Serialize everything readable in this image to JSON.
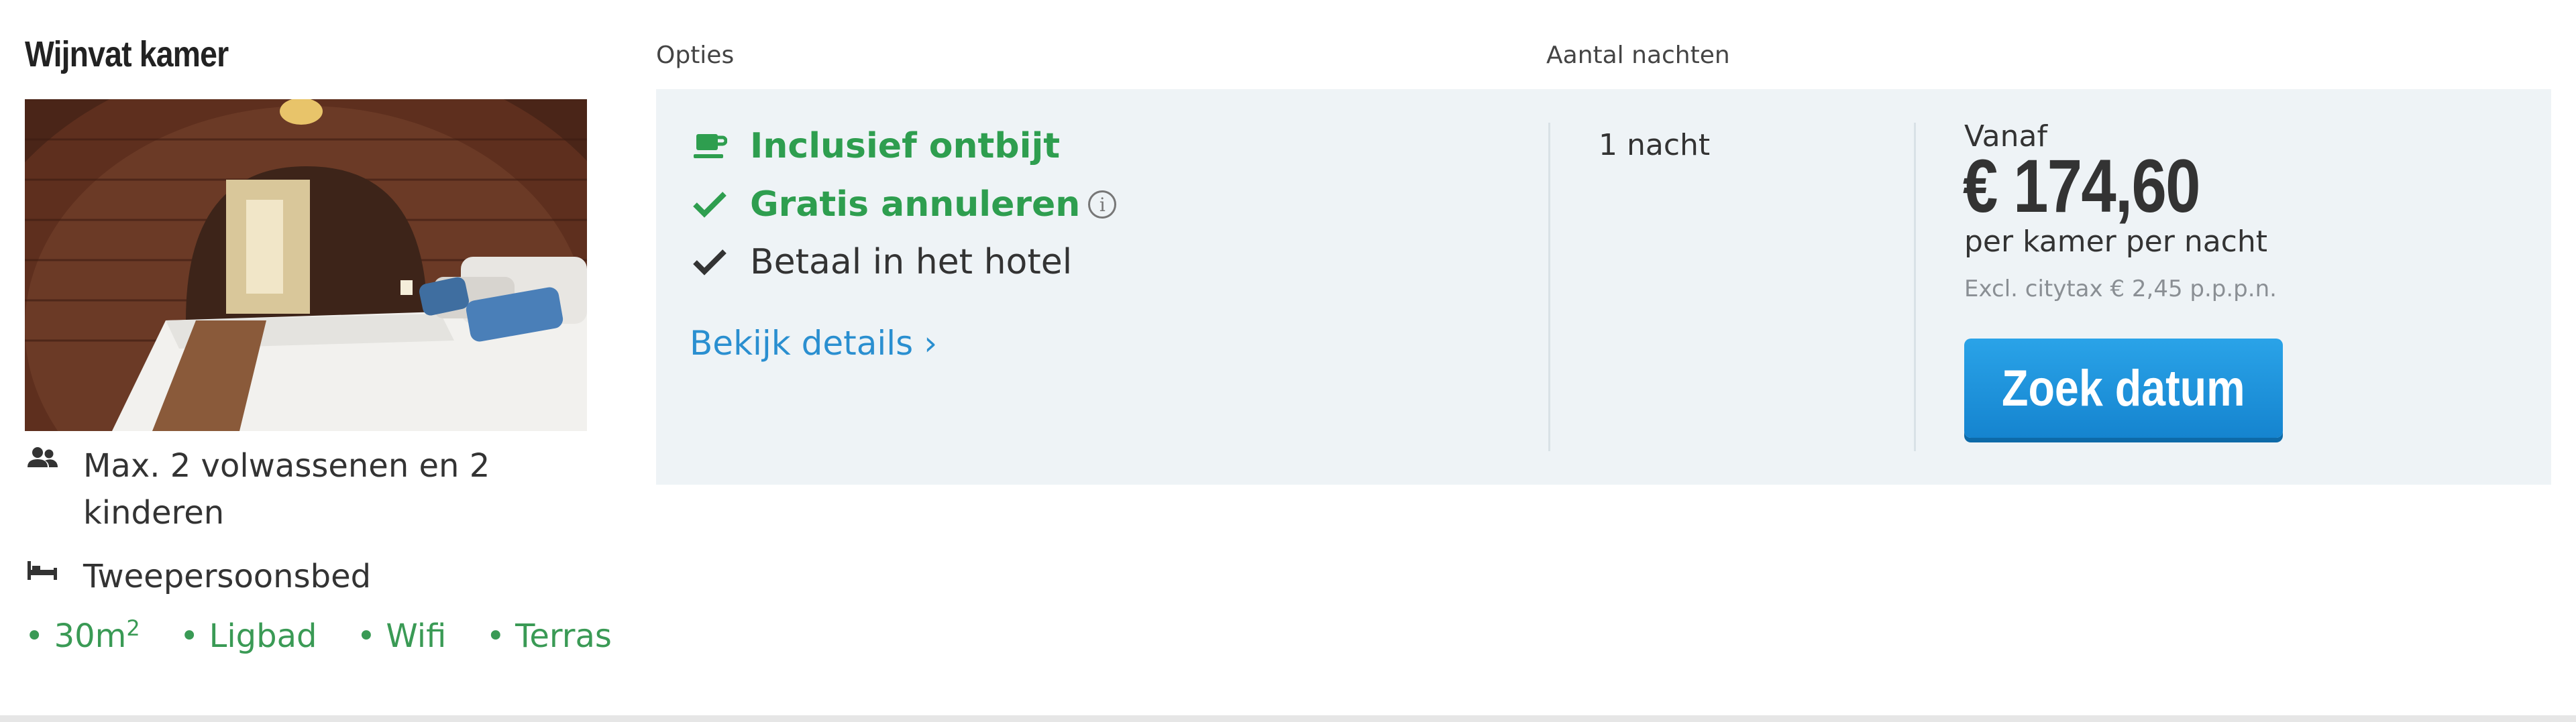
{
  "room": {
    "title": "Wijnvat kamer",
    "features": [
      {
        "icon": "guests-icon",
        "text": "Max. 2 volwassenen en 2 kinderen"
      },
      {
        "icon": "bed-icon",
        "text": "Tweepersoonsbed"
      }
    ],
    "amenities": {
      "size": "• 30m",
      "size_sup": "2",
      "items": [
        "• Ligbad",
        "• Wifi",
        "• Terras"
      ]
    }
  },
  "columns": {
    "options_label": "Opties",
    "nights_label": "Aantal nachten"
  },
  "options": {
    "items": [
      {
        "icon": "coffee-cup-icon",
        "text": "Inclusief ontbijt",
        "style": "green"
      },
      {
        "icon": "check-icon",
        "text": "Gratis annuleren",
        "style": "green",
        "info_icon": "info-icon"
      },
      {
        "icon": "check-icon",
        "text": "Betaal in het hotel",
        "style": "plain"
      }
    ],
    "details_link": "Bekijk details  ›"
  },
  "nights": {
    "value": "1 nacht"
  },
  "price": {
    "from_label": "Vanaf",
    "amount": "€ 174,60",
    "per_label": "per kamer per nacht",
    "tax_note": "Excl. citytax € 2,45 p.p.p.n.",
    "button_label": "Zoek datum"
  },
  "colors": {
    "green": "#2e9e4f",
    "link_blue": "#2a8fd0",
    "button_blue": "#1a8fd8",
    "panel_bg": "#eef3f6"
  }
}
